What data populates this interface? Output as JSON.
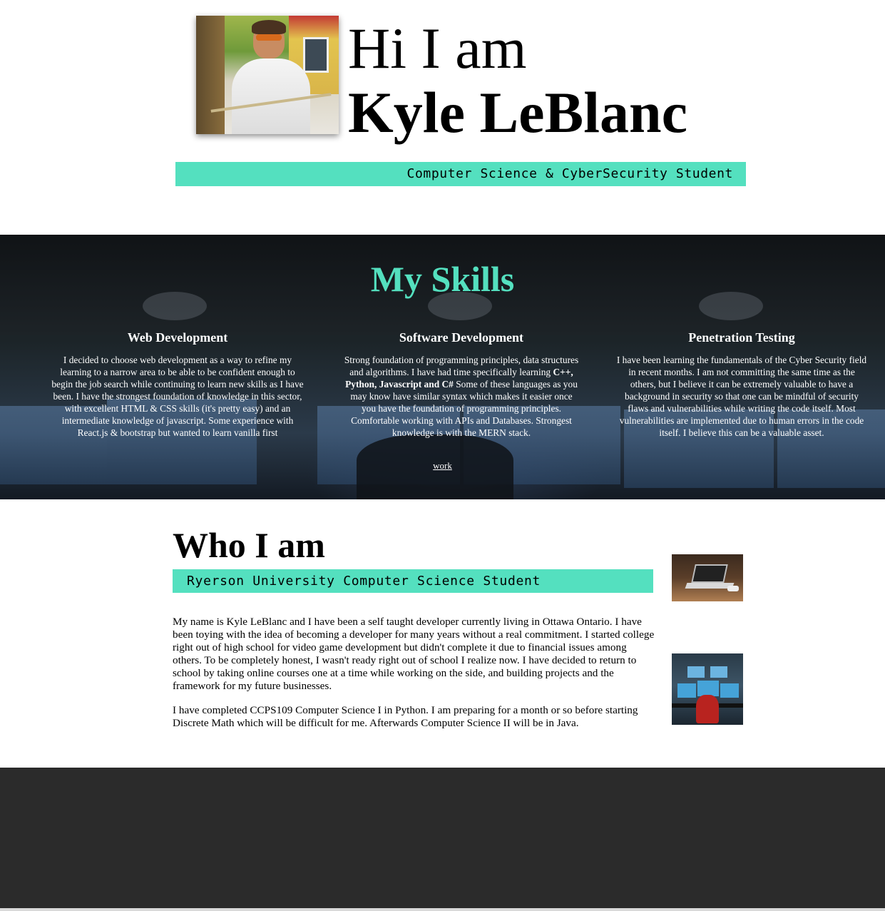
{
  "hero": {
    "greeting": "Hi I am",
    "name": "Kyle LeBlanc",
    "tagline": "Computer Science & CyberSecurity Student"
  },
  "skills": {
    "title": "My Skills",
    "columns": [
      {
        "heading": "Web Development",
        "text": "I decided to choose web development as a way to refine my learning to a narrow area to be able to be confident enough to begin the job search while continuing to learn new skills as I have been. I have the strongest foundation of knowledge in this sector, with excellent HTML & CSS skills (it's pretty easy) and an intermediate knowledge of javascript. Some experience with React.js & bootstrap but wanted to learn vanilla first"
      },
      {
        "heading": "Software Development",
        "text_before": "Strong foundation of programming principles, data structures and algorithms. I have had time specifically learning ",
        "text_bold": "C++, Python, Javascript and C#",
        "text_after": " Some of these languages as you may know have similar syntax which makes it easier once you have the foundation of programming principles. Comfortable working with APIs and Databases. Strongest knowledge is with the MERN stack."
      },
      {
        "heading": "Penetration Testing",
        "text": "I have been learning the fundamentals of the Cyber Security field in recent months. I am not committing the same time as the others, but I believe it can be extremely valuable to have a background in security so that one can be mindful of security flaws and vulnerabilities while writing the code itself. Most vulnerabilities are implemented due to human errors in the code itself. I believe this can be a valuable asset."
      }
    ],
    "work_link": "work"
  },
  "who": {
    "title": "Who I am",
    "subtitle": "Ryerson University Computer Science Student",
    "paragraphs": [
      "My name is Kyle LeBlanc and I have been a self taught developer currently living in Ottawa Ontario. I have been toying with the idea of becoming a developer for many years without a real commitment. I started college right out of high school for video game development but didn't complete it due to financial issues among others. To be completely honest, I wasn't ready right out of school I realize now. I have decided to return to school by taking online courses one at a time while working on the side, and building projects and the framework for my future businesses.",
      "I have completed CCPS109 Computer Science I in Python. I am preparing for a month or so before starting Discrete Math which will be difficult for me. Afterwards Computer Science II will be in Java."
    ]
  },
  "colors": {
    "accent": "#54e0bf",
    "footer": "#2b2b2b"
  }
}
